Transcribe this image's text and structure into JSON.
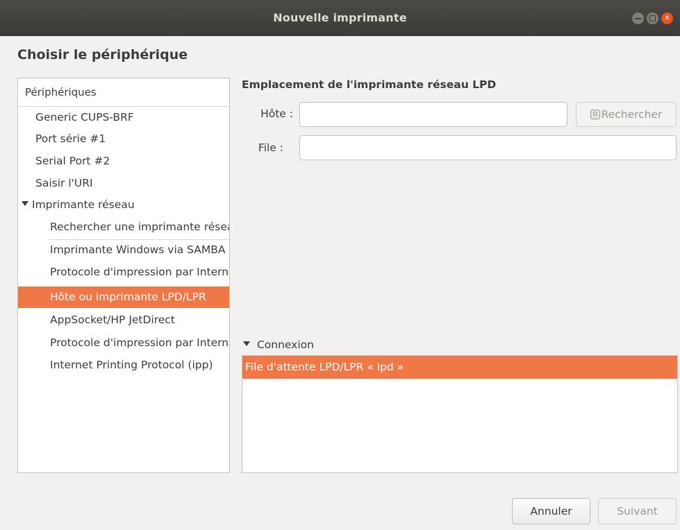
{
  "window": {
    "title": "Nouvelle imprimante"
  },
  "heading": "Choisir le périphérique",
  "devices": {
    "header": "Périphériques",
    "items": [
      "Generic CUPS-BRF",
      "Port série #1",
      "Serial Port #2",
      "Saisir l'URI",
      "Imprimante réseau",
      "Rechercher une imprimante réseau",
      "Imprimante Windows via SAMBA",
      "Protocole d'impression par Internet (ipps)",
      "Hôte ou imprimante LPD/LPR",
      "AppSocket/HP JetDirect",
      "Protocole d'impression par Internet (https)",
      "Internet Printing Protocol (ipp)"
    ],
    "selected": "Hôte ou imprimante LPD/LPR"
  },
  "form": {
    "section_title": "Emplacement de l'imprimante réseau LPD",
    "host_label": "Hôte :",
    "host_value": "",
    "search_button": "Rechercher",
    "queue_label": "File :",
    "queue_value": ""
  },
  "connection": {
    "label": "Connexion",
    "items": [
      "File d'attente LPD/LPR « lpd »"
    ]
  },
  "buttons": {
    "cancel": "Annuler",
    "next": "Suivant"
  },
  "colors": {
    "accent": "#f07746",
    "titlebar": "#3c3b37",
    "close": "#e95420"
  }
}
